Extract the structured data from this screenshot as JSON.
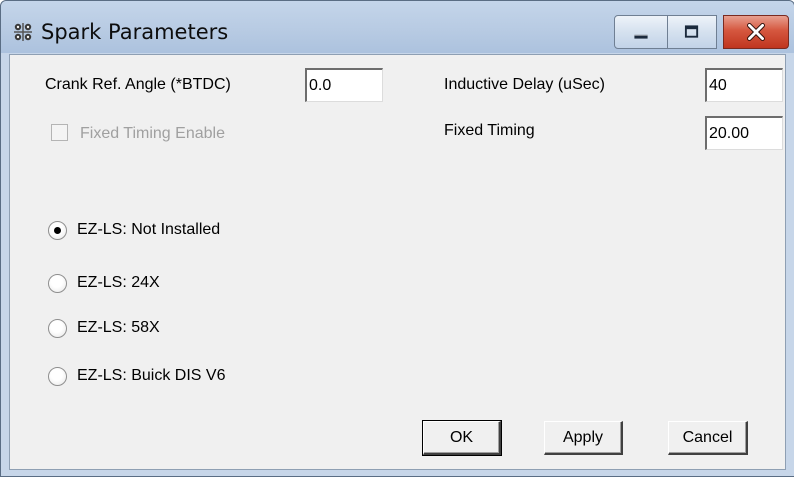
{
  "window": {
    "title": "Spark Parameters"
  },
  "fields": {
    "crank_ref_angle": {
      "label": "Crank Ref. Angle (*BTDC)",
      "value": "0.0"
    },
    "inductive_delay": {
      "label": "Inductive Delay (uSec)",
      "value": "40"
    },
    "fixed_timing": {
      "label": "Fixed Timing",
      "value": "20.00"
    }
  },
  "checkbox": {
    "fixed_timing_enable": {
      "label": "Fixed Timing Enable",
      "checked": false,
      "enabled": false
    }
  },
  "radios": [
    {
      "label": "EZ-LS: Not Installed",
      "selected": true
    },
    {
      "label": "EZ-LS: 24X",
      "selected": false
    },
    {
      "label": "EZ-LS: 58X",
      "selected": false
    },
    {
      "label": "EZ-LS: Buick DIS V6",
      "selected": false
    }
  ],
  "buttons": {
    "ok": "OK",
    "apply": "Apply",
    "cancel": "Cancel"
  }
}
